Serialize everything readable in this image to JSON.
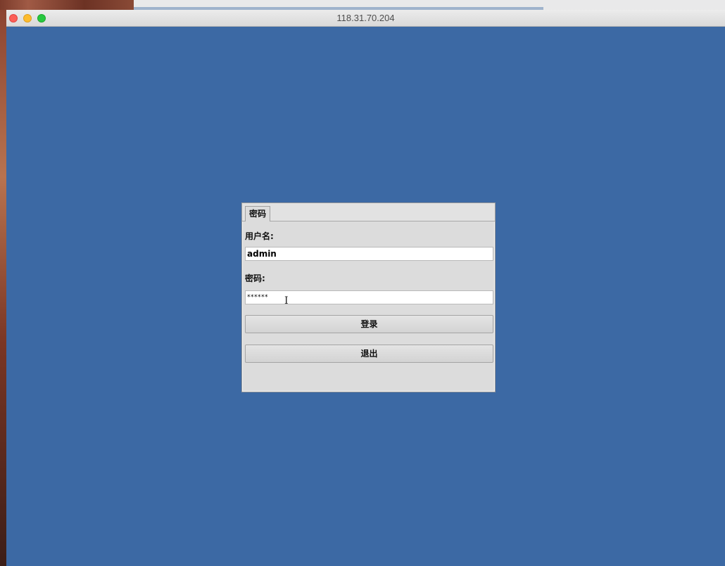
{
  "window": {
    "title": "118.31.70.204"
  },
  "login_dialog": {
    "tab_label": "密码",
    "username_label": "用户名:",
    "username_value": "admin",
    "password_label": "密码:",
    "password_value": "******",
    "login_button_label": "登录",
    "exit_button_label": "退出"
  },
  "colors": {
    "desktop_background": "#3c69a4",
    "dialog_background": "#dcdcdc",
    "close_button": "#fc5f57",
    "minimize_button": "#fdbc2e",
    "maximize_button": "#28c840"
  },
  "icons": {
    "text_cursor": "i-beam-cursor-icon"
  }
}
